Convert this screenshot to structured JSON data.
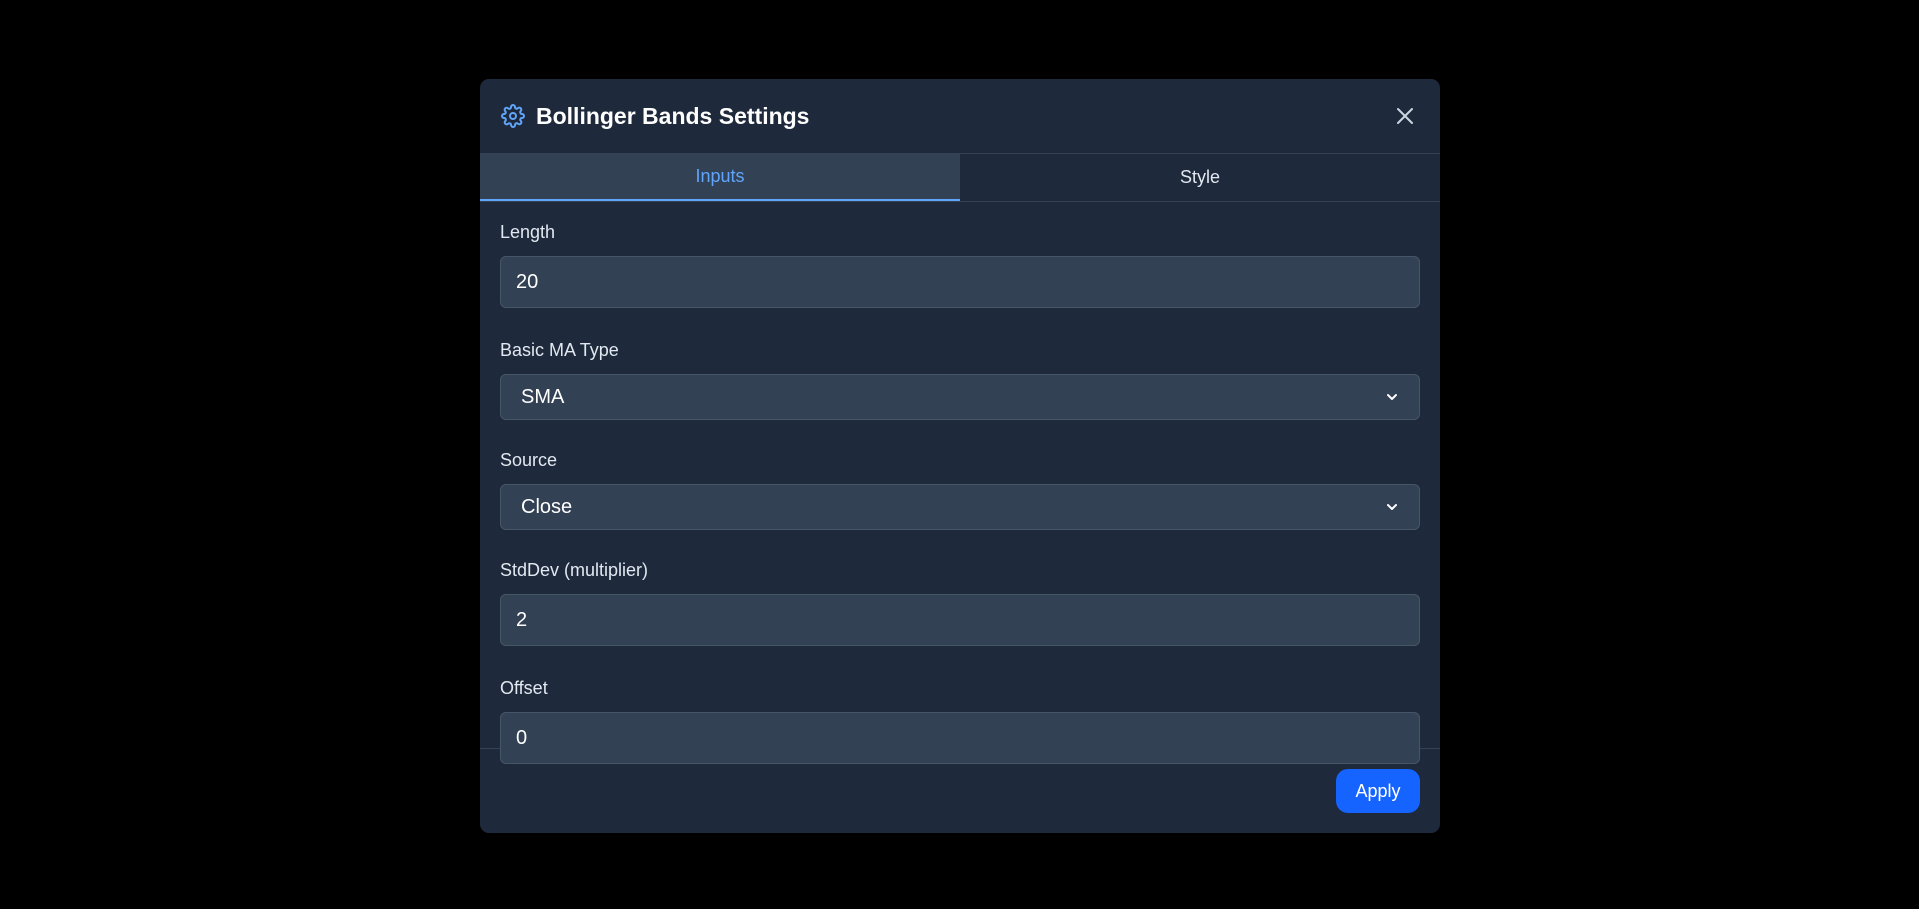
{
  "dialog": {
    "title": "Bollinger Bands Settings",
    "header_icon": "gear-icon",
    "close_icon": "close-icon",
    "accent_color": "#60a5fa",
    "button_color": "#1664ff"
  },
  "tabs": [
    {
      "label": "Inputs",
      "active": true
    },
    {
      "label": "Style",
      "active": false
    }
  ],
  "fields": {
    "length": {
      "label": "Length",
      "value": "20"
    },
    "ma_type": {
      "label": "Basic MA Type",
      "value": "SMA"
    },
    "source": {
      "label": "Source",
      "value": "Close"
    },
    "stddev": {
      "label": "StdDev (multiplier)",
      "value": "2"
    },
    "offset": {
      "label": "Offset",
      "value": "0"
    }
  },
  "footer": {
    "apply_label": "Apply"
  }
}
